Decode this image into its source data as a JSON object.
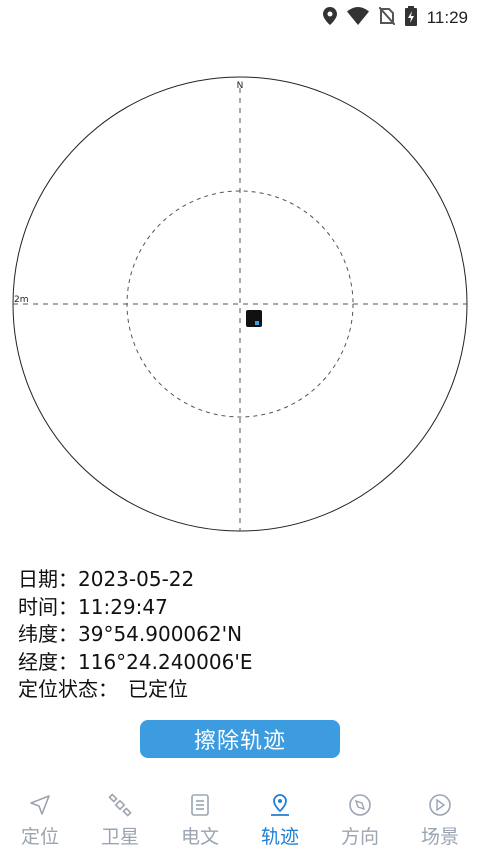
{
  "status_bar": {
    "time": "11:29",
    "icons": [
      "location-icon",
      "wifi-icon",
      "no-sim-icon",
      "battery-charging-icon"
    ]
  },
  "radar": {
    "north_label": "N",
    "scale_label": "2m"
  },
  "info": {
    "date_label": "日期：",
    "date_value": "2023-05-22",
    "time_label": "时间：",
    "time_value": "11:29:47",
    "lat_label": "纬度：",
    "lat_value": "39°54.900062'N",
    "lon_label": "经度：",
    "lon_value": "116°24.240006'E",
    "status_label": "定位状态：",
    "status_value": "已定位"
  },
  "clear_button": {
    "label": "擦除轨迹"
  },
  "nav": {
    "tabs": [
      {
        "label": "定位",
        "icon": "navigation-arrow-icon",
        "active": false
      },
      {
        "label": "卫星",
        "icon": "satellite-icon",
        "active": false
      },
      {
        "label": "电文",
        "icon": "document-icon",
        "active": false
      },
      {
        "label": "轨迹",
        "icon": "track-pin-icon",
        "active": true
      },
      {
        "label": "方向",
        "icon": "compass-icon",
        "active": false
      },
      {
        "label": "场景",
        "icon": "scene-icon",
        "active": false
      }
    ]
  },
  "colors": {
    "accent": "#1f7fd3",
    "button": "#3d9be0",
    "inactive": "#9aa5b1"
  }
}
